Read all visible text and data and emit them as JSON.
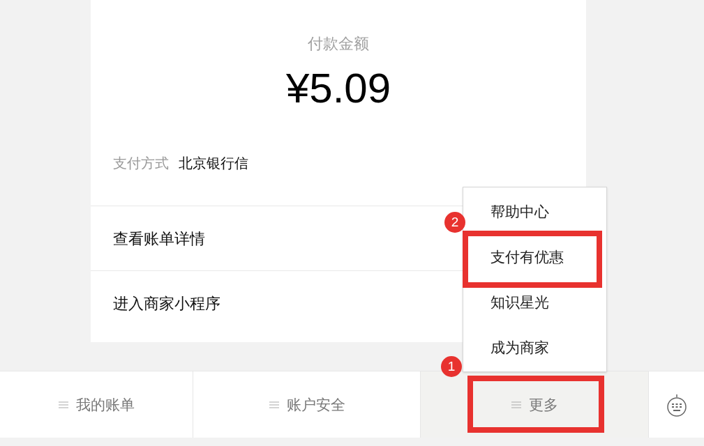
{
  "payment": {
    "title": "付款金额",
    "amount": "¥5.09",
    "method_label": "支付方式",
    "method_value": "北京银行信"
  },
  "actions": [
    {
      "label": "查看账单详情"
    },
    {
      "label": "进入商家小程序"
    }
  ],
  "menu": {
    "open": true,
    "items": [
      {
        "label": "帮助中心"
      },
      {
        "label": "支付有优惠",
        "annotation": "2"
      },
      {
        "label": "知识星光"
      },
      {
        "label": "成为商家"
      }
    ]
  },
  "tabs": [
    {
      "label": "我的账单",
      "selected": false
    },
    {
      "label": "账户安全",
      "selected": false
    },
    {
      "label": "更多",
      "selected": true,
      "annotation": "1"
    }
  ]
}
